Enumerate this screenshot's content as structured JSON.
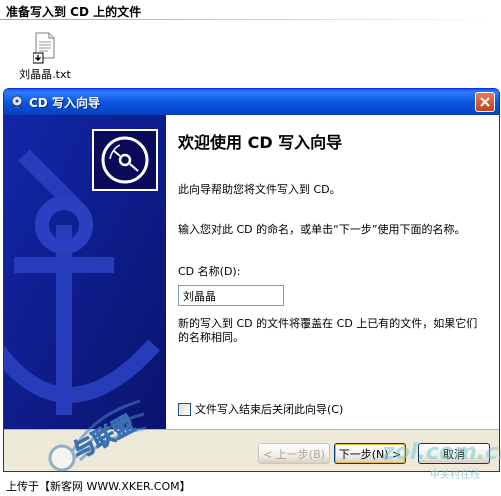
{
  "explorer": {
    "header": "准备写入到 CD 上的文件",
    "file_name": "刘晶晶.txt"
  },
  "window": {
    "title": "CD 写入向导",
    "close_label": "✕"
  },
  "wizard": {
    "heading": "欢迎使用 CD 写入向导",
    "intro": "此向导帮助您将文件写入到 CD。",
    "instruction": "输入您对此 CD 的命名，或单击“下一步”使用下面的名称。",
    "name_label": "CD 名称(D):",
    "name_value": "刘晶晶",
    "warning": "新的写入到 CD 的文件将覆盖在 CD 上已有的文件，如果它们的名称相同。",
    "close_checkbox_label": "文件写入结束后关闭此向导(C)",
    "close_checkbox_checked": false
  },
  "buttons": {
    "back": "< 上一步(B)",
    "next": "下一步(N) >",
    "cancel": "取消"
  },
  "caption": "上传于【新客网 WWW.XKER.COM】",
  "watermarks": {
    "left": "与联盟",
    "right": "zol.com.cn",
    "right_sub": "中关村在线"
  },
  "colors": {
    "titlebar": "#0b57e0",
    "banner": "#0c1a8a",
    "close_button": "#c8401c"
  }
}
